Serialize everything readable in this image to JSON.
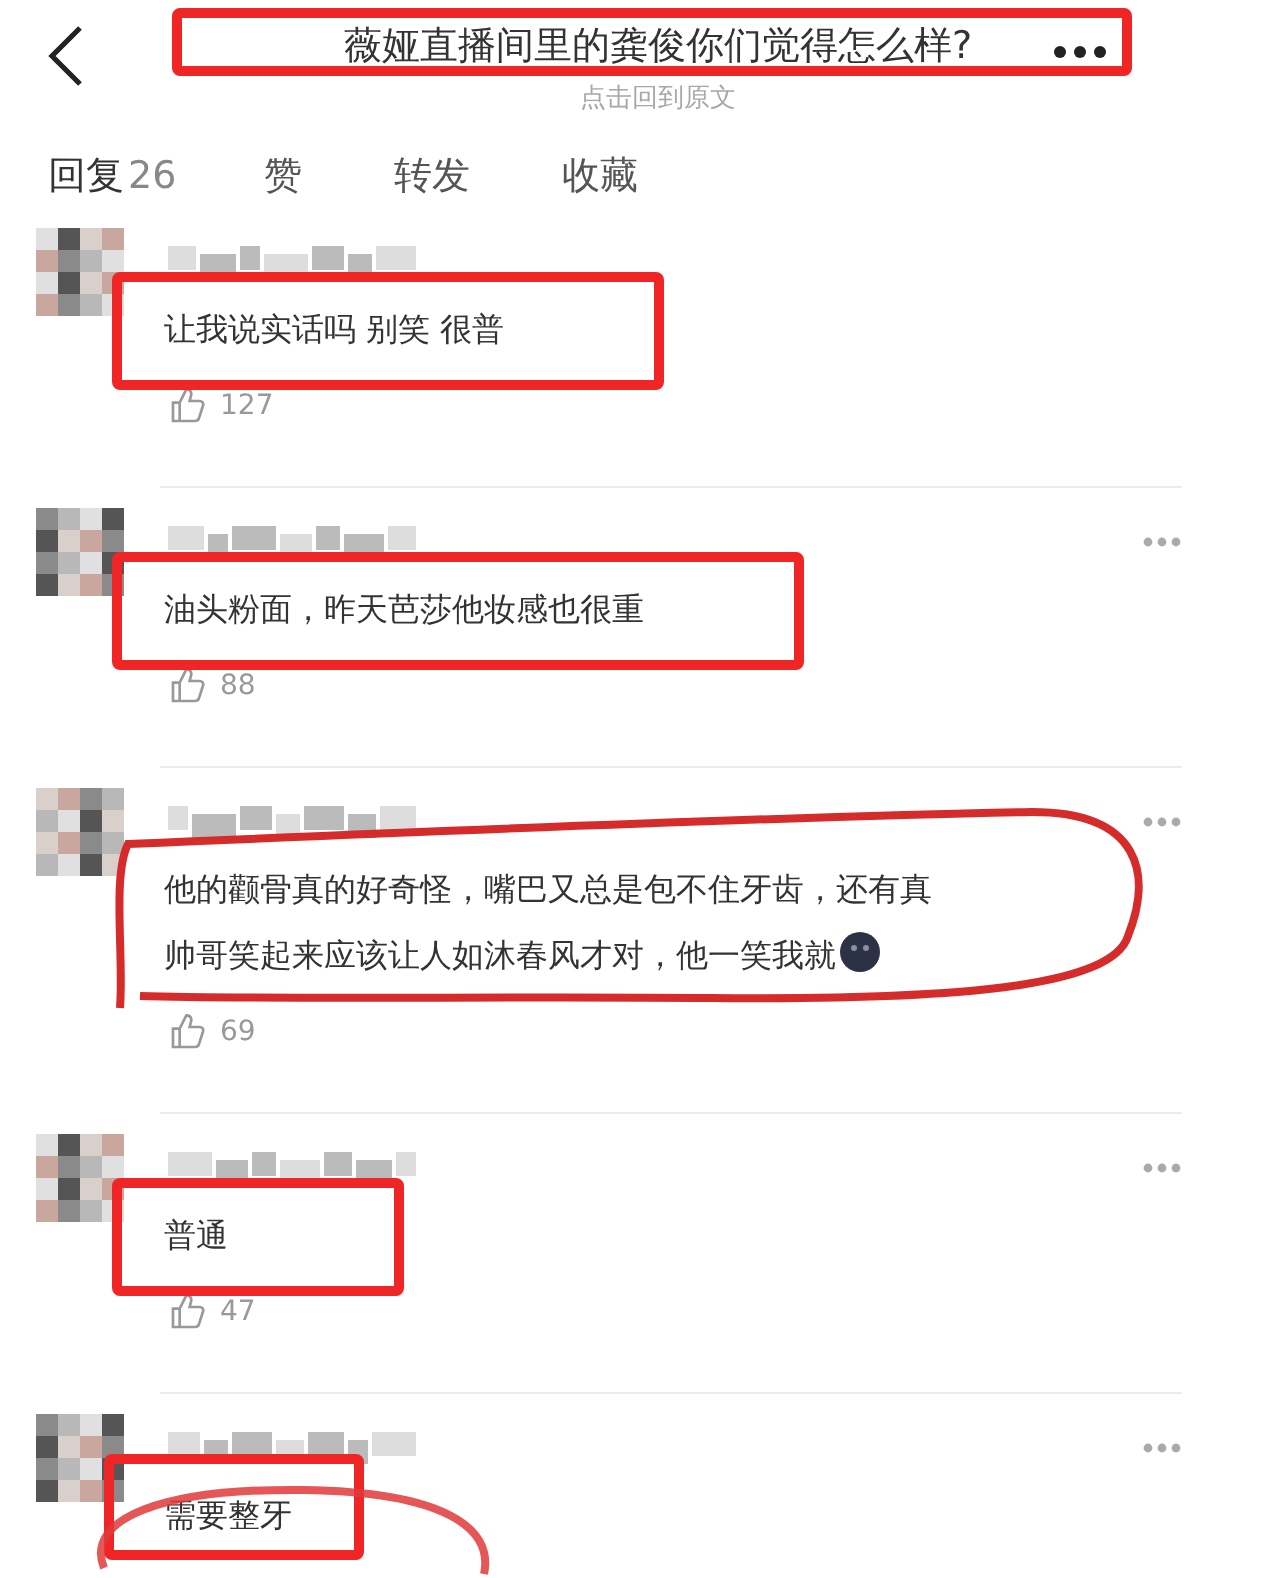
{
  "header": {
    "title": "薇娅直播间里的龚俊你们觉得怎么样?",
    "subtitle": "点击回到原文",
    "highlight": {
      "kind": "box"
    }
  },
  "tabs": [
    {
      "label": "回复",
      "count": "26",
      "selected": true
    },
    {
      "label": "赞",
      "selected": false
    },
    {
      "label": "转发",
      "selected": false
    },
    {
      "label": "收藏",
      "selected": false
    }
  ],
  "comments": [
    {
      "text": "让我说实话吗 别笑 很普",
      "likes": "127",
      "highlight": {
        "kind": "box"
      },
      "menu": false
    },
    {
      "text": "油头粉面，昨天芭莎他妆感也很重",
      "likes": "88",
      "highlight": {
        "kind": "box"
      },
      "menu": true
    },
    {
      "text": "他的颧骨真的好奇怪，嘴巴又总是包不住牙齿，还有真帅哥笑起来应该让人如沐春风才对，他一笑我就",
      "likes": "69",
      "highlight": {
        "kind": "loop"
      },
      "menu": true,
      "emoji": true
    },
    {
      "text": "普通",
      "likes": "47",
      "highlight": {
        "kind": "box"
      },
      "menu": true
    },
    {
      "text": "需要整牙",
      "highlight": {
        "kind": "box_oval"
      },
      "menu": true
    }
  ]
}
